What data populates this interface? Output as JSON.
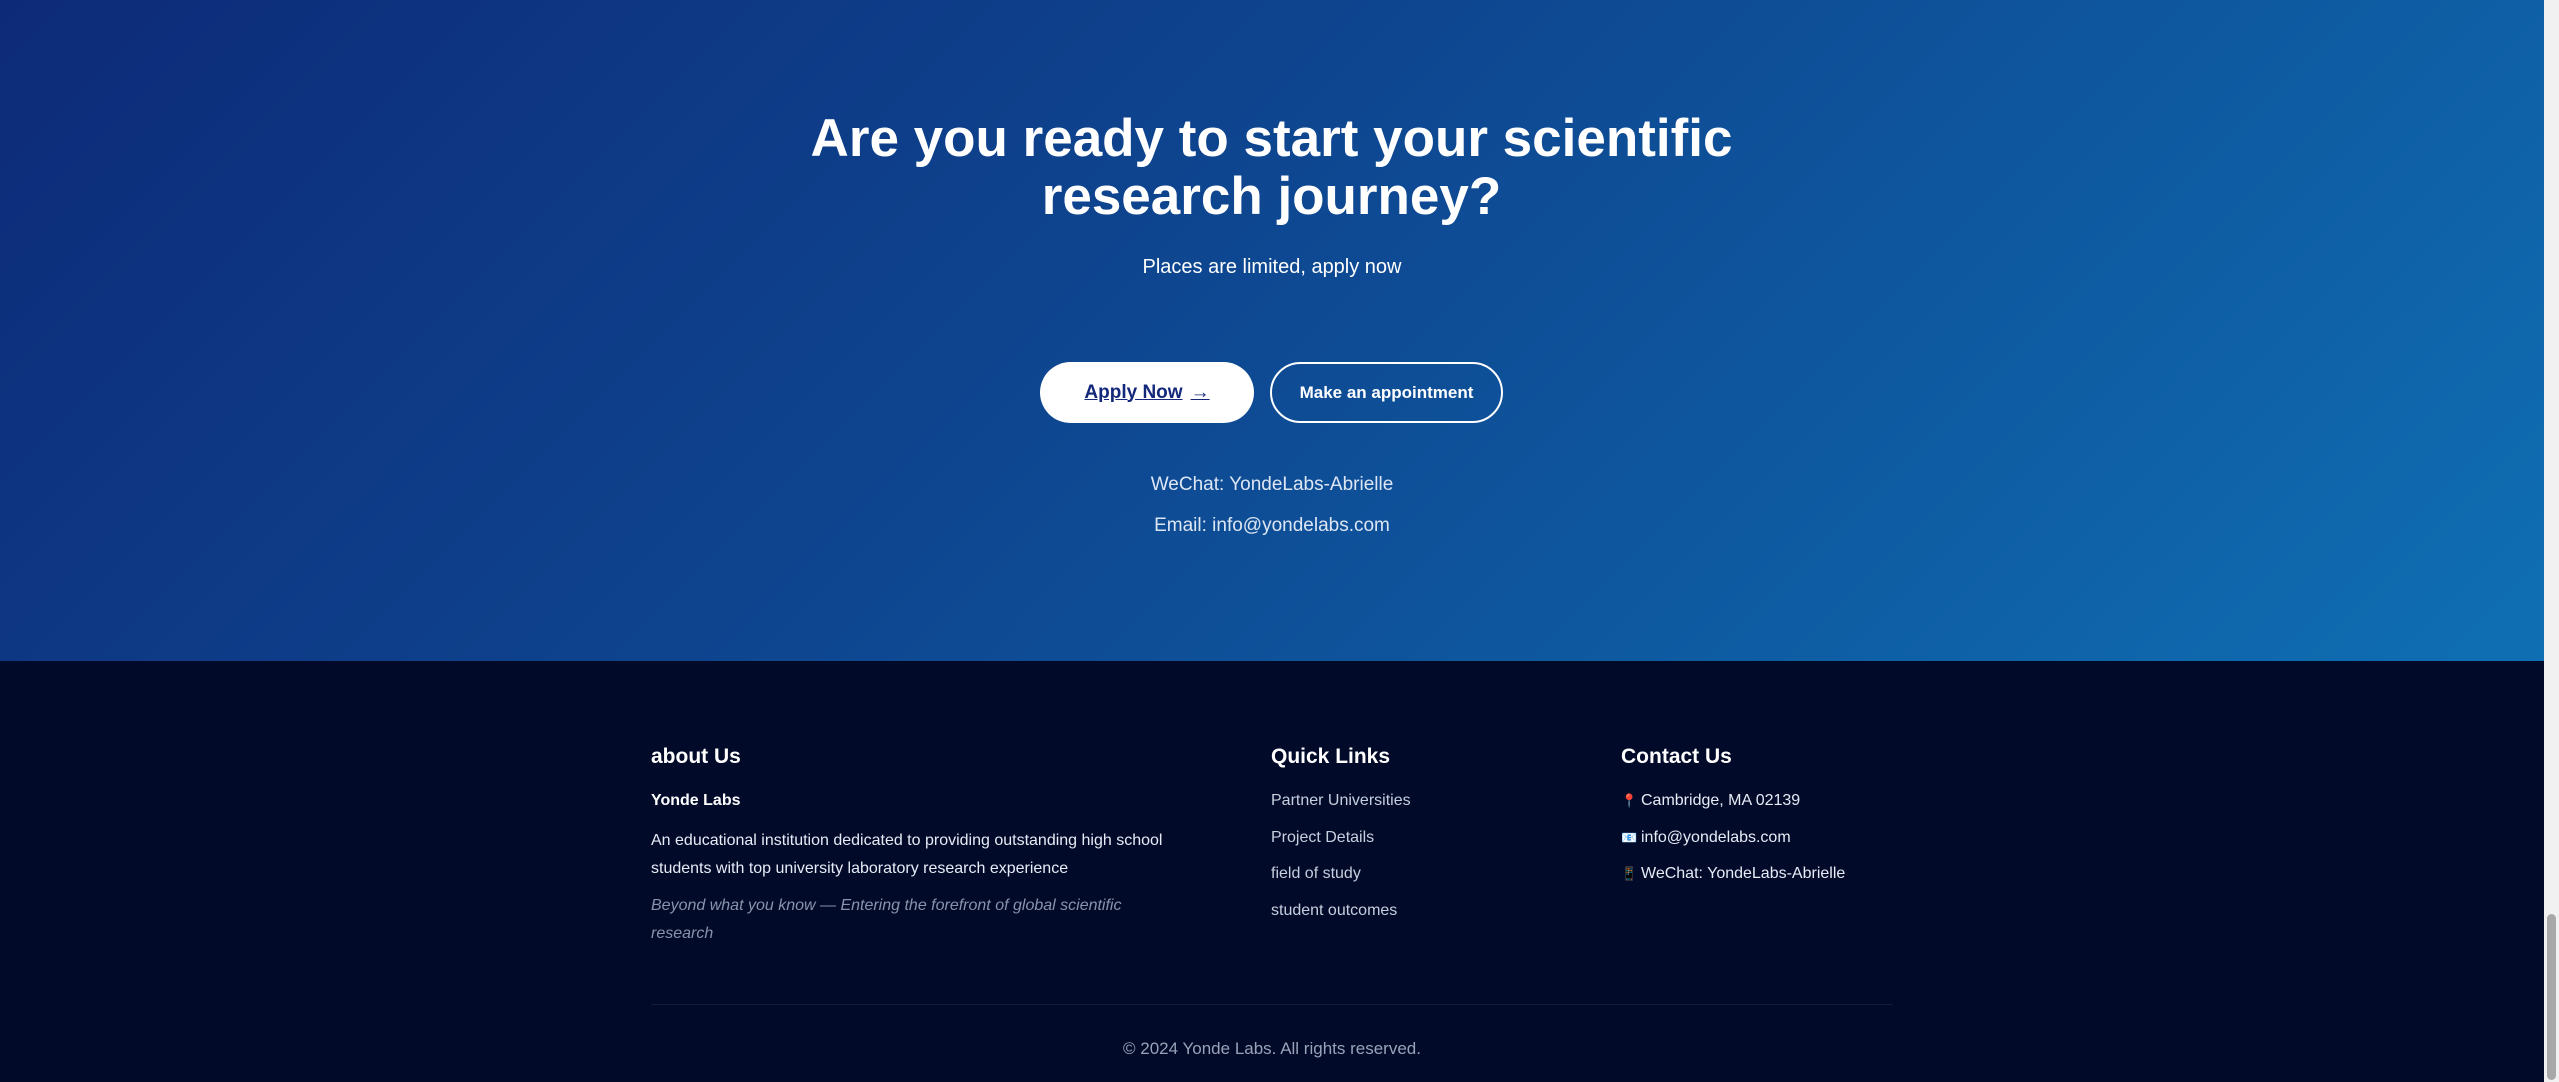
{
  "cta": {
    "title": "Are you ready to start your scientific research journey?",
    "subtitle": "Places are limited, apply now",
    "apply_label": "Apply Now",
    "apply_arrow": "→",
    "appointment_label": "Make an appointment",
    "wechat": "WeChat: YondeLabs-Abrielle",
    "email": "Email: info@yondelabs.com"
  },
  "footer": {
    "about": {
      "heading": "about Us",
      "name": "Yonde Labs",
      "description": "An educational institution dedicated to providing outstanding high school students with top university laboratory research experience",
      "motto": "Beyond what you know — Entering the forefront of global scientific research"
    },
    "quick_links": {
      "heading": "Quick Links",
      "items": [
        {
          "label": "Partner Universities"
        },
        {
          "label": "Project Details"
        },
        {
          "label": "field of study"
        },
        {
          "label": "student outcomes"
        }
      ]
    },
    "contact": {
      "heading": "Contact Us",
      "address": "Cambridge, MA 02139",
      "address_icon": "📍",
      "email": "info@yondelabs.com",
      "email_icon": "📧",
      "wechat": "WeChat: YondeLabs-Abrielle",
      "wechat_icon": "📱"
    },
    "copyright": "© 2024 Yonde Labs. All rights reserved."
  },
  "colors": {
    "cta_gradient_start": "#0d2a78",
    "cta_gradient_end": "#0f6fb3",
    "footer_bg": "#020a2a",
    "apply_text": "#13287a"
  }
}
